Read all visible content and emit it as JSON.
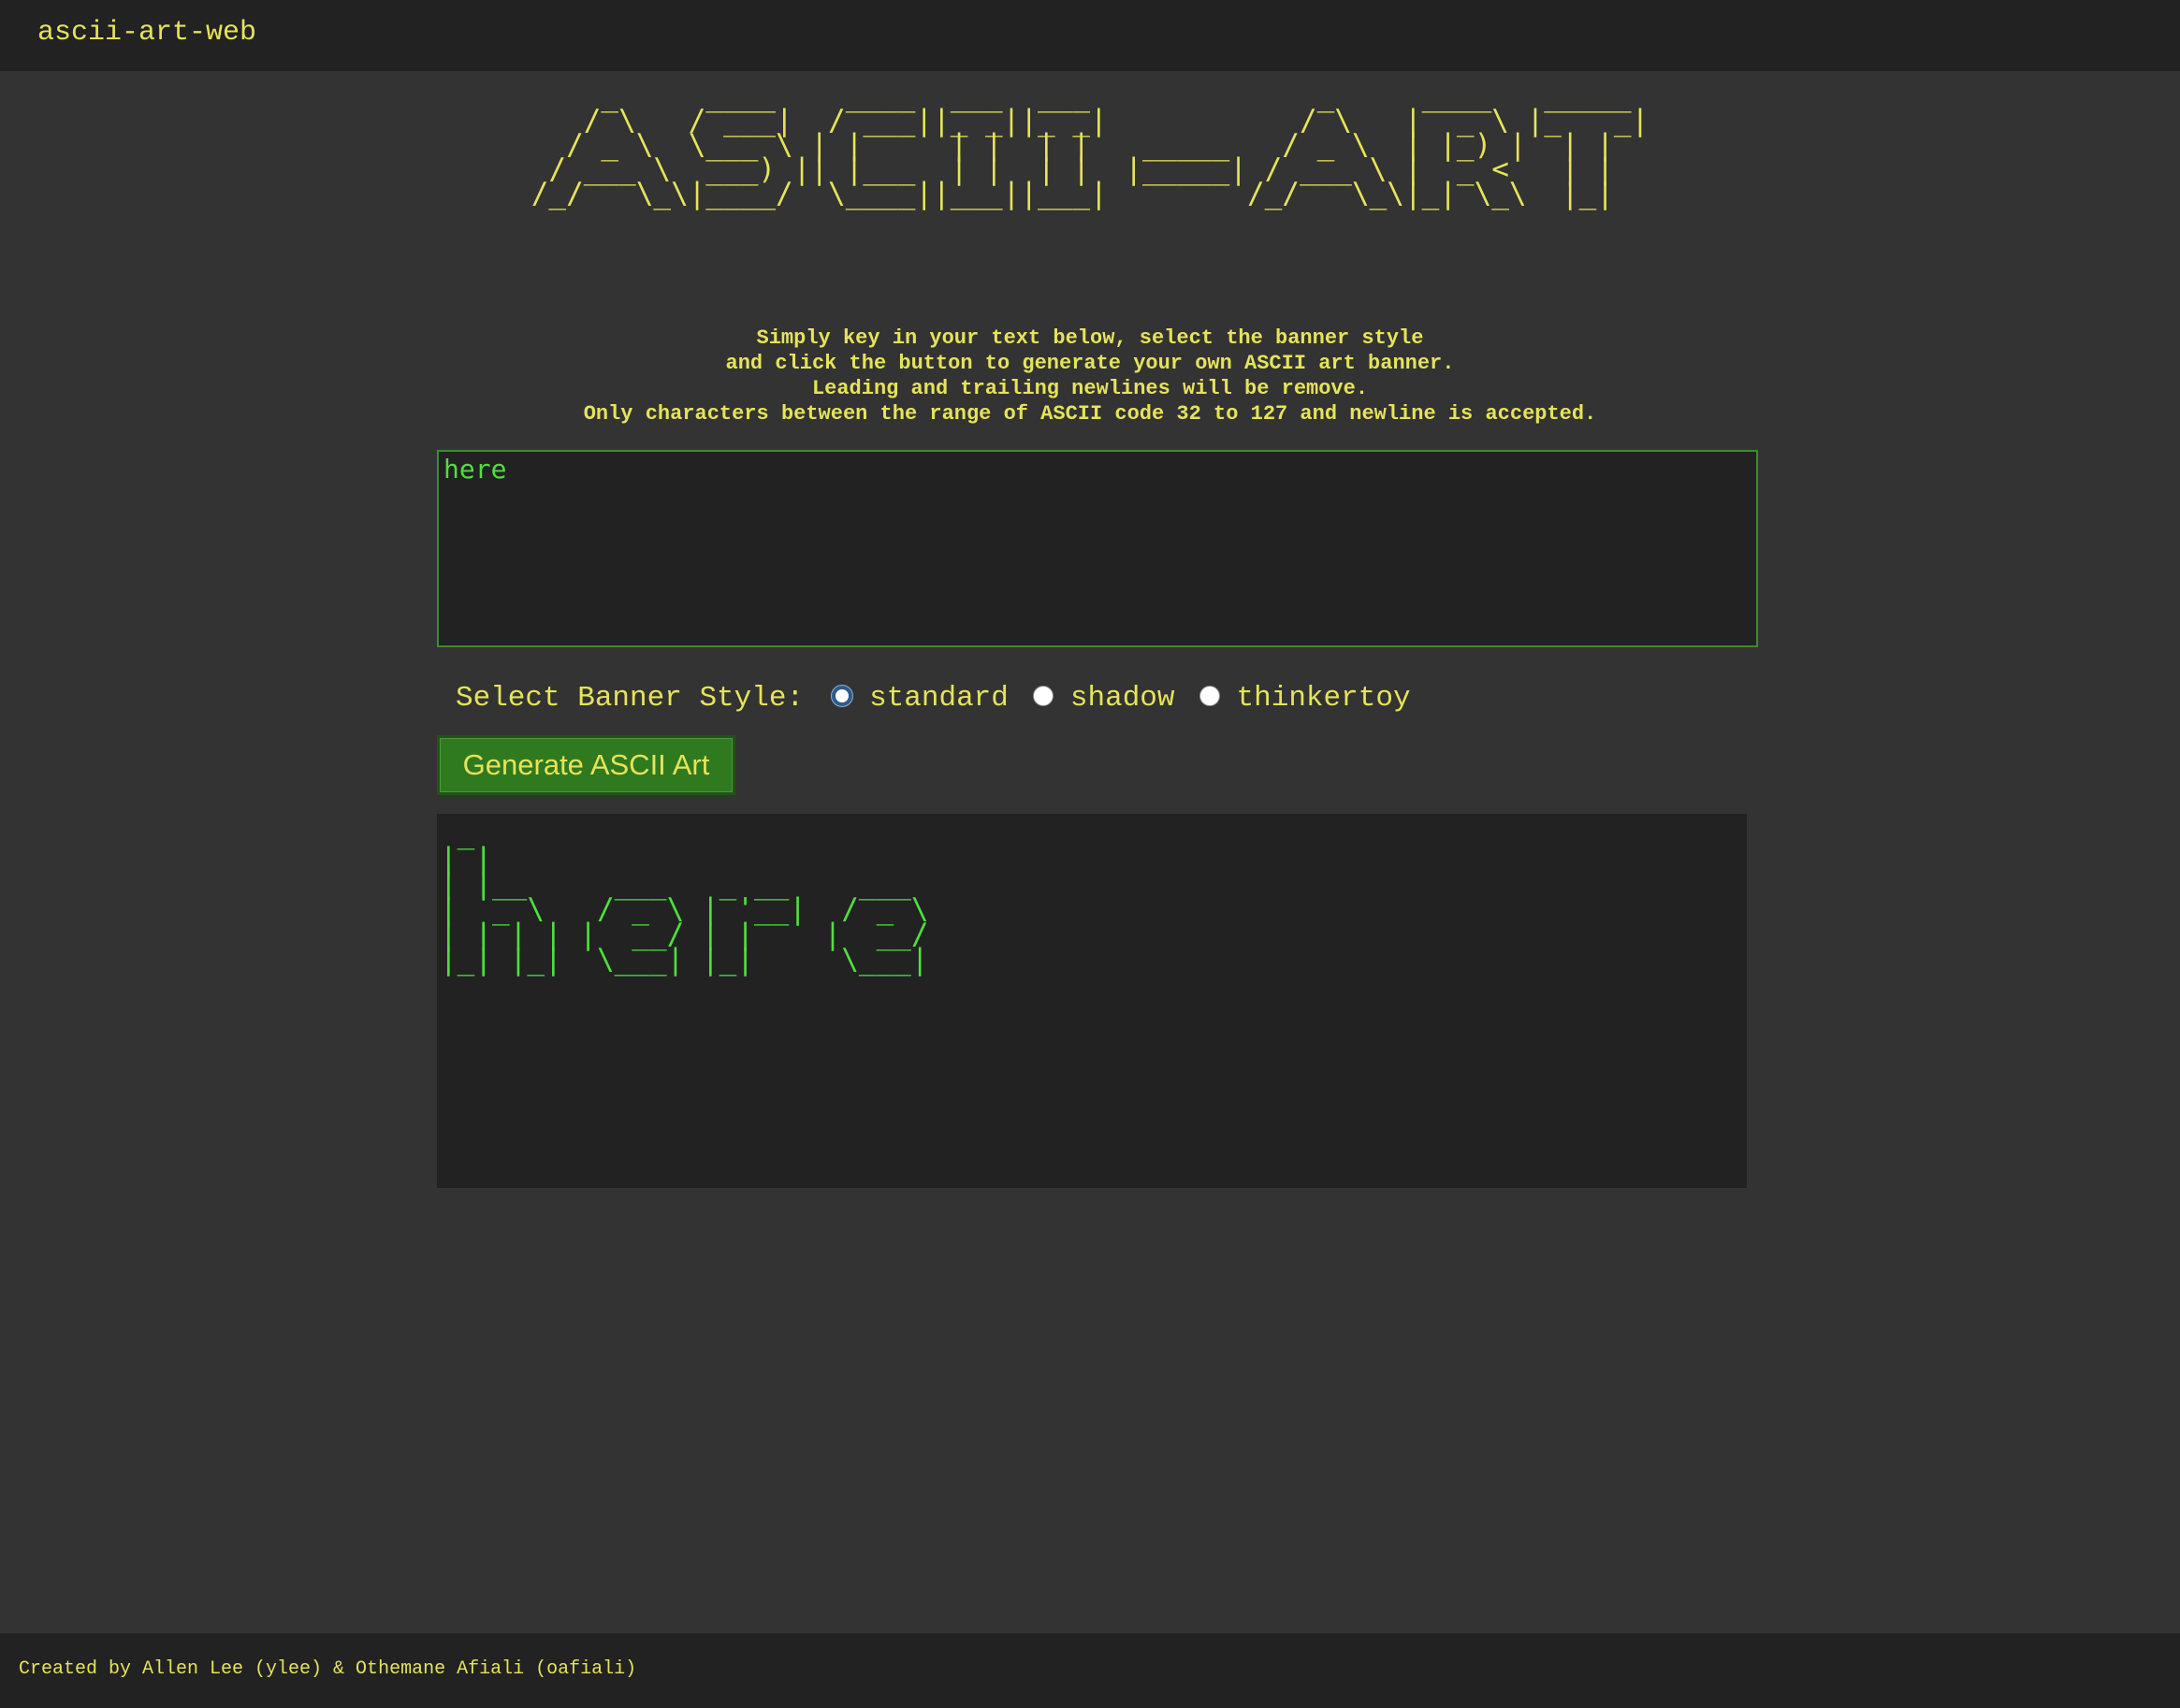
{
  "header": {
    "title": "ascii-art-web"
  },
  "banner": {
    "art": "    _     ____    ____  ___  ___             _     ____   _____ \n   / \\   / ___|  / ___||_ _||_ _|           / \\   |  _ \\ |_   _|\n  / _ \\  \\___ \\ | |     | |  | |   _____   / _ \\  | |_) |  | |  \n / ___ \\  ___) || |___  | |  | |  |_____| / ___ \\ |  _ <   | |  \n/_/   \\_\\|____/  \\____||___||___|        /_/   \\_\\|_| \\_\\  |_|  "
  },
  "instructions": {
    "lines": [
      "Simply key in your text below, select the banner style",
      "and click the button to generate your own ASCII art banner.",
      "Leading and trailing newlines will be remove.",
      "Only characters between the range of ASCII code 32 to 127 and newline is accepted."
    ]
  },
  "form": {
    "input_value": "here",
    "style_label": "Select Banner Style:",
    "styles": [
      {
        "label": "standard",
        "checked": true
      },
      {
        "label": "shadow",
        "checked": false
      },
      {
        "label": "thinkertoy",
        "checked": false
      }
    ],
    "generate_label": "Generate ASCII Art"
  },
  "output": {
    "art": " _                           \n| |                          \n| |__     ___   _ __    ___  \n|  _ \\   / _ \\ | '__|  / _ \\ \n| | | | |  __/ | |    |  __/ \n|_| |_|  \\___| |_|     \\___| "
  },
  "footer": {
    "credit": "Created by Allen Lee (ylee) & Othemane Afiali (oafiali)"
  },
  "colors": {
    "accent_yellow": "#e6e35a",
    "output_green": "#4fe03e",
    "button_green": "#2f7a1f",
    "background": "#333333",
    "panel": "#222222"
  }
}
